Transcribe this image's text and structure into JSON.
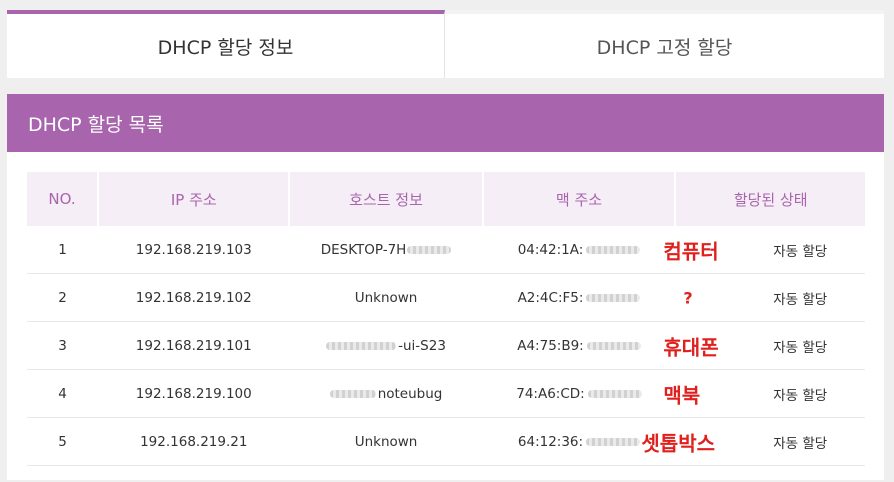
{
  "tabs": [
    {
      "label": "DHCP 할당 정보",
      "active": true
    },
    {
      "label": "DHCP 고정 할당",
      "active": false
    }
  ],
  "panel": {
    "title": "DHCP 할당 목록"
  },
  "table": {
    "headers": [
      "NO.",
      "IP 주소",
      "호스트 정보",
      "맥 주소",
      "할당된 상태"
    ],
    "rows": [
      {
        "no": "1",
        "ip": "192.168.219.103",
        "host": "DESKTOP-7H",
        "host_suffix_masked": true,
        "host_prefix_masked": false,
        "mac": "04:42:1A:",
        "state": "자동 할당",
        "note": "컴퓨터"
      },
      {
        "no": "2",
        "ip": "192.168.219.102",
        "host": "Unknown",
        "host_suffix_masked": false,
        "host_prefix_masked": false,
        "mac": "A2:4C:F5:",
        "state": "자동 할당",
        "note": "?"
      },
      {
        "no": "3",
        "ip": "192.168.219.101",
        "host": "-ui-S23",
        "host_suffix_masked": false,
        "host_prefix_masked": true,
        "mac": "A4:75:B9:",
        "state": "자동 할당",
        "note": "휴대폰"
      },
      {
        "no": "4",
        "ip": "192.168.219.100",
        "host": "noteubug",
        "host_suffix_masked": false,
        "host_prefix_masked": true,
        "mac": "74:A6:CD:",
        "state": "자동 할당",
        "note": "맥북"
      },
      {
        "no": "5",
        "ip": "192.168.219.21",
        "host": "Unknown",
        "host_suffix_masked": false,
        "host_prefix_masked": false,
        "mac": "64:12:36:",
        "state": "자동 할당",
        "note": "셋톱박스"
      }
    ]
  },
  "colors": {
    "accent": "#a865ad",
    "header_bg": "#f6eef6",
    "note_red": "#e0201c"
  }
}
